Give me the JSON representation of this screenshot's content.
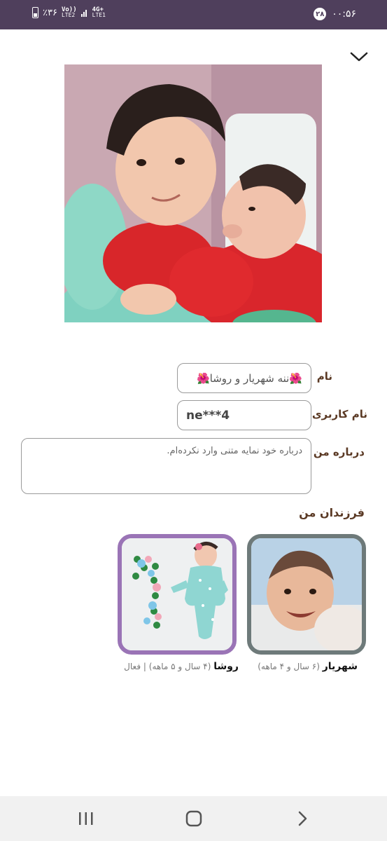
{
  "status_bar": {
    "time": "۰۰:۵۶",
    "notification_count": "۲۸",
    "battery_percent": "٪۳۶",
    "sim2_network": "LTE2",
    "sim1_network": "LTE1",
    "sim1_tech": "4G+",
    "volte_label": "Vo))"
  },
  "profile": {
    "name_label": "نام",
    "name_value": "🌺ننه شهریار و روشا🌺",
    "username_label": "نام کاربری",
    "username_value": "ne***4",
    "about_label": "درباره من",
    "about_placeholder": "درباره خود نمایه متنی وارد نکرده‌ام."
  },
  "children_section": {
    "title": "فرزندان من",
    "children": [
      {
        "name": "شهریار",
        "age": "(۶ سال و ۴ ماهه)",
        "status": "",
        "border_color": "#6e7a7a"
      },
      {
        "name": "روشا",
        "age": "(۴ سال و ۵ ماهه)",
        "status": "| فعال",
        "border_color": "#9a74b6"
      }
    ]
  },
  "icons": {
    "collapse": "chevron-down-icon",
    "nav_recents": "recents-icon",
    "nav_home": "home-icon",
    "nav_back": "back-icon"
  }
}
